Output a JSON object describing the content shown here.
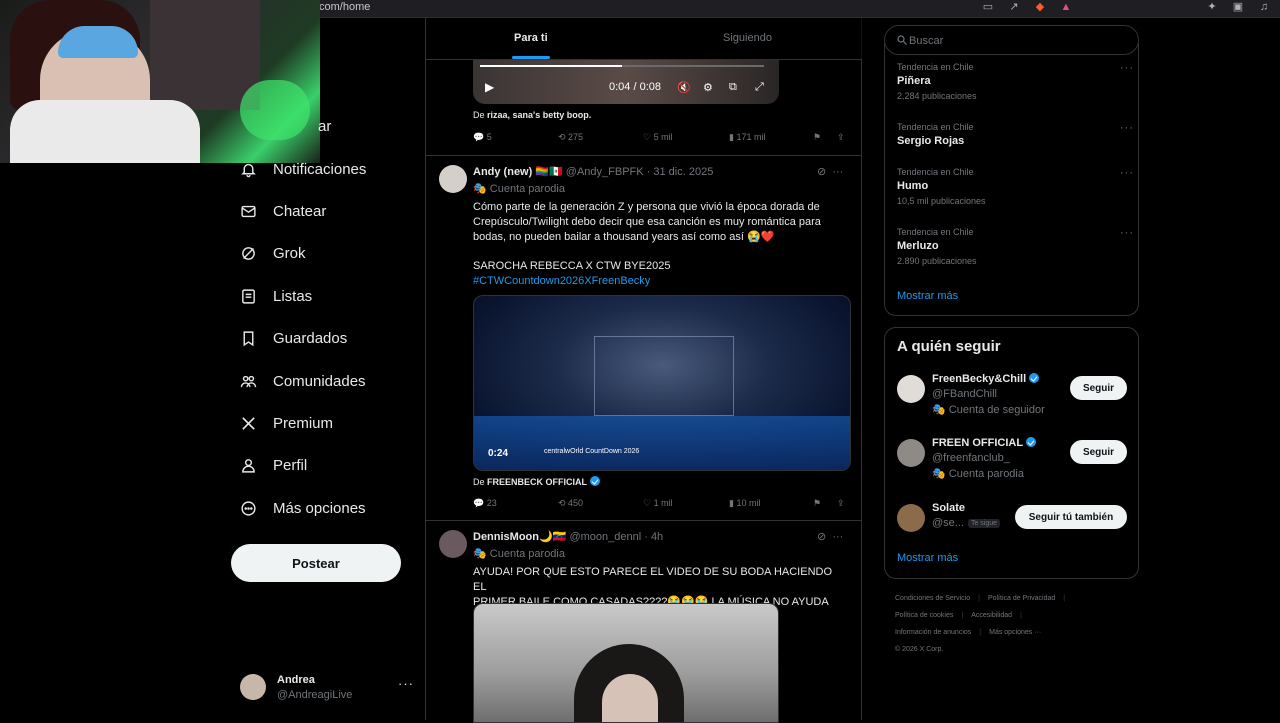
{
  "browser": {
    "url": "com/home"
  },
  "nav": {
    "partial_label": "ar",
    "items": [
      {
        "label": "Notificaciones",
        "icon": "bell-icon"
      },
      {
        "label": "Chatear",
        "icon": "mail-icon"
      },
      {
        "label": "Grok",
        "icon": "grok-icon"
      },
      {
        "label": "Listas",
        "icon": "list-icon"
      },
      {
        "label": "Guardados",
        "icon": "bookmark-icon"
      },
      {
        "label": "Comunidades",
        "icon": "communities-icon"
      },
      {
        "label": "Premium",
        "icon": "x-logo-icon"
      },
      {
        "label": "Perfil",
        "icon": "person-icon"
      },
      {
        "label": "Más opciones",
        "icon": "more-circle-icon"
      }
    ],
    "post_button": "Postear"
  },
  "account": {
    "name": "Andrea",
    "handle": "@AndreagiLive",
    "more": "···"
  },
  "tabs": {
    "for_you": "Para ti",
    "following": "Siguiendo"
  },
  "video_top": {
    "time": "0:04 / 0:08",
    "from_prefix": "De",
    "from_name": "rizaa, sana's betty boop."
  },
  "post0_actions": {
    "replies": "5",
    "reposts": "275",
    "likes": "5 mil",
    "views": "171 mil"
  },
  "post1": {
    "name": "Andy (new) 🏳️‍🌈🇲🇽",
    "meta": "@Andy_FBPFK · 31 dic. 2025",
    "badge": "Cuenta parodia",
    "text_l1": "Cómo parte de la generación Z y persona que vivió la época dorada de",
    "text_l2": "Crepúsculo/Twilight debo decir que esa canción es muy romántica para",
    "text_l3": "bodas, no pueden bailar a thousand years así como así 😭❤️",
    "text_l4": "SAROCHA REBECCA X CTW BYE2025",
    "hashtag": "#CTWCountdown2026XFreenBecky",
    "video_duration": "0:24",
    "video_overlay": "centralwOrld CountDown 2026",
    "from_prefix": "De",
    "from_name": "FREENBECK OFFICIAL",
    "replies": "23",
    "reposts": "450",
    "likes": "1 mil",
    "views": "10 mil"
  },
  "post2": {
    "name": "DennisMoon🌙🇻🇪",
    "meta": "@moon_dennl · 4h",
    "badge": "Cuenta parodia",
    "text_l1": "AYUDA! POR QUE ESTO PARECE EL VIDEO DE SU BODA HACIENDO EL",
    "text_l2": "PRIMER BAILE COMO CASADAS????😭😭😭 LA MÚSICA NO AYUDA"
  },
  "search": {
    "placeholder": "Buscar"
  },
  "trends": [
    {
      "context": "Tendencia en Chile",
      "title": "Piñera",
      "count": "2.284 publicaciones"
    },
    {
      "context": "Tendencia en Chile",
      "title": "Sergio Rojas",
      "count": ""
    },
    {
      "context": "Tendencia en Chile",
      "title": "Humo",
      "count": "10,5 mil publicaciones"
    },
    {
      "context": "Tendencia en Chile",
      "title": "Merluzo",
      "count": "2.890 publicaciones"
    }
  ],
  "trends_more": "Mostrar más",
  "who_to_follow": {
    "title": "A quién seguir",
    "accounts": [
      {
        "name": "FreenBecky&Chill",
        "handle": "@FBandChill",
        "extra": "Cuenta de seguidor",
        "button": "Seguir"
      },
      {
        "name": "FREEN OFFICIAL",
        "handle": "@freenfanclub_",
        "extra": "Cuenta parodia",
        "button": "Seguir"
      },
      {
        "name": "Solate",
        "handle": "@se...",
        "tag": "Te sigue",
        "button": "Seguir tú también"
      }
    ],
    "more": "Mostrar más"
  },
  "footer": {
    "l1a": "Condiciones de Servicio",
    "l1b": "Política de Privacidad",
    "l2a": "Política de cookies",
    "l2b": "Accesibilidad",
    "l3a": "Información de anuncios",
    "l3b": "Más opciones ···",
    "copyright": "© 2026 X Corp."
  }
}
